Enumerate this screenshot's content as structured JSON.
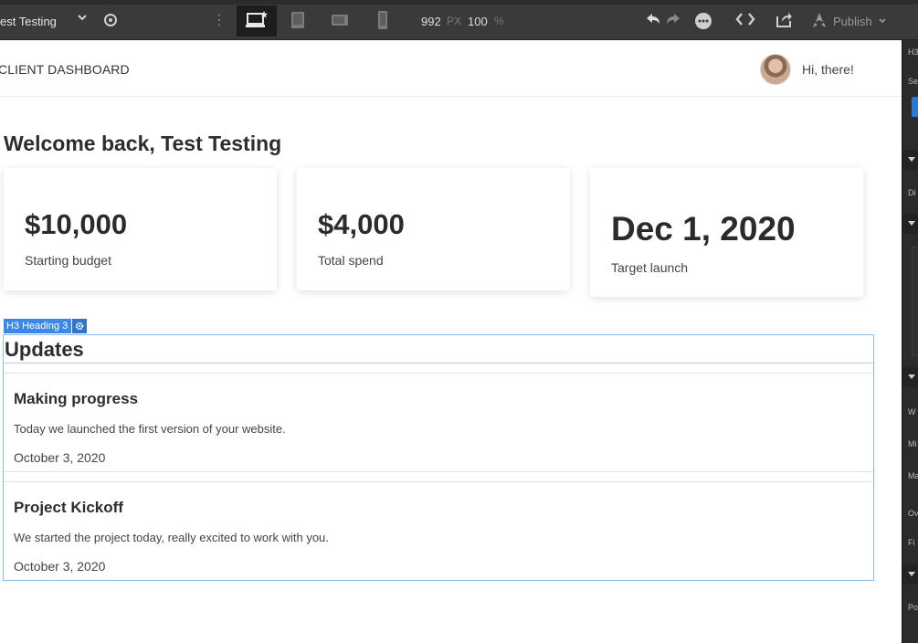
{
  "toolbar": {
    "site_name": "est Testing",
    "breakpoint_width": "992",
    "width_unit": "PX",
    "zoom": "100",
    "zoom_unit": "%",
    "publish_label": "Publish",
    "icons": [
      "chevron-down-icon",
      "eye-icon",
      "vertical-dots-icon",
      "desktop-icon",
      "tablet-icon",
      "tablet-landscape-icon",
      "phone-icon",
      "undo-icon",
      "redo-icon",
      "more-icon",
      "code-icon",
      "export-icon",
      "rocket-icon"
    ]
  },
  "panel": {
    "labels": [
      "H3",
      "Se",
      "Di",
      "W",
      "Mi",
      "Ma",
      "Ov",
      "Fi",
      "Po"
    ],
    "accent": "#2d78d3"
  },
  "page": {
    "brand": "CLIENT DASHBOARD",
    "greeting": "Hi, there!",
    "welcome": "Welcome back, Test Testing",
    "cards": [
      {
        "value": "$10,000",
        "label": "Starting budget"
      },
      {
        "value": "$4,000",
        "label": "Total spend"
      },
      {
        "value": "Dec 1, 2020",
        "label": "Target launch"
      }
    ],
    "selection_badge": "H3 Heading 3",
    "updates_title": "Updates",
    "updates": [
      {
        "title": "Making progress",
        "text": "Today we launched the first version of your website.",
        "date": "October 3, 2020"
      },
      {
        "title": "Project Kickoff",
        "text": "We started the project today, really excited to work with you.",
        "date": "October 3, 2020"
      }
    ]
  },
  "colors": {
    "selection_outline": "#8fbbe9",
    "badge_blue": "#3b88e8",
    "toolbar_bg": "#3a3a3a"
  }
}
